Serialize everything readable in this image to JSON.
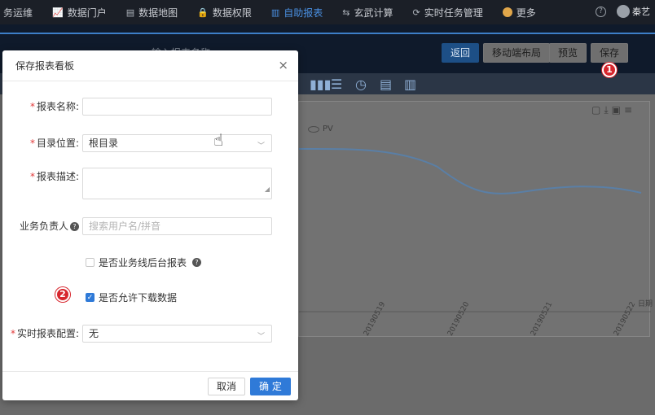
{
  "nav": {
    "items": [
      {
        "label": "务运维",
        "icon": ""
      },
      {
        "label": "数据门户",
        "icon": "chart-line-icon"
      },
      {
        "label": "数据地图",
        "icon": "document-list-icon"
      },
      {
        "label": "数据权限",
        "icon": "lock-icon"
      },
      {
        "label": "自助报表",
        "icon": "bar-chart-icon",
        "active": true
      },
      {
        "label": "玄武计算",
        "icon": "swap-icon"
      },
      {
        "label": "实时任务管理",
        "icon": "refresh-icon"
      },
      {
        "label": "更多",
        "icon": "more-icon"
      }
    ],
    "help_icon": "?",
    "user_name": "秦艺"
  },
  "toolbar": {
    "report_name_placeholder": "输入报表名称",
    "back_label": "返回",
    "mobile_layout_label": "移动端布局",
    "preview_label": "预览",
    "save_label": "保存"
  },
  "chart_data": {
    "type": "line",
    "series": [
      {
        "name": "PV",
        "values": [
          null,
          null,
          null,
          null
        ]
      }
    ],
    "categories": [
      "20190519",
      "20190520",
      "20190521",
      "20190522"
    ],
    "xlabel": "日期",
    "legend": "top-left"
  },
  "modal": {
    "title": "保存报表看板",
    "close": "×",
    "fields": {
      "name_label": "报表名称:",
      "name_value": "",
      "dir_label": "目录位置:",
      "dir_value": "根目录",
      "desc_label": "报表描述:",
      "desc_value": "",
      "owner_label": "业务负责人",
      "owner_placeholder": "搜索用户名/拼音",
      "backend_label": "是否业务线后台报表",
      "download_label": "是否允许下载数据",
      "realtime_label": "实时报表配置:",
      "realtime_value": "无"
    },
    "cancel_label": "取消",
    "confirm_label": "确 定"
  },
  "annotations": {
    "step1": "1",
    "step2": "2"
  }
}
